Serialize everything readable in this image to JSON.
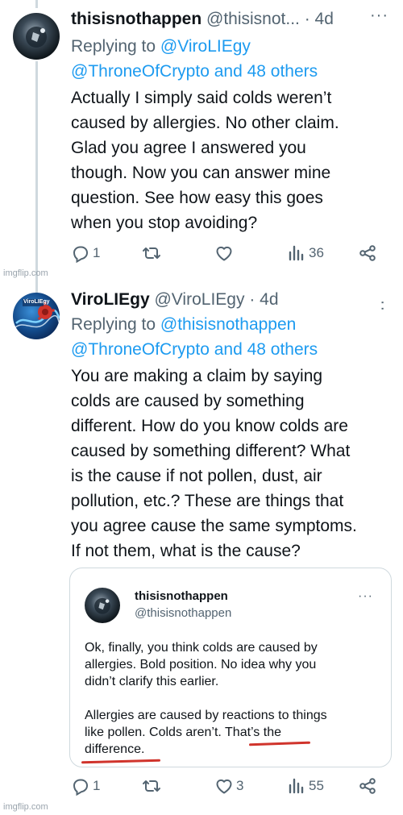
{
  "tweet1": {
    "name": "thisisnothappen",
    "handle": "@thisisnot...",
    "time": "· 4d",
    "replying_prefix": "Replying to ",
    "reply_to_1": "@ViroLIEgy",
    "reply_to_2": "@ThroneOfCrypto and 48 others",
    "lines": [
      "Actually I simply said colds weren’t",
      "caused by allergies. No other claim.",
      "Glad you agree I answered you",
      "though. Now you can answer mine",
      "question. See how easy this goes",
      "when you stop avoiding?"
    ],
    "replies": "1",
    "views": "36"
  },
  "tweet2": {
    "name": "ViroLIEgy",
    "handle": "@ViroLIEgy",
    "time": "· 4d",
    "avatar_text": "ViroLIEgy",
    "replying_prefix": "Replying to ",
    "reply_to_1": "@thisisnothappen",
    "reply_to_2": "@ThroneOfCrypto and 48 others",
    "lines": [
      "You are making a claim by saying",
      "colds are caused by something",
      "different. How do you know colds are",
      "caused by something different? What",
      "is the cause if not pollen, dust, air",
      "pollution, etc.? These are things that",
      "you agree cause the same symptoms.",
      "If not them, what is the cause?"
    ],
    "replies": "1",
    "likes": "3",
    "views": "55"
  },
  "quote": {
    "name": "thisisnothappen",
    "handle": "@thisisnothappen",
    "more": "···",
    "para1": [
      "Ok, finally, you think colds are caused by",
      "allergies. Bold position. No idea why you",
      "didn’t clarify this earlier."
    ],
    "para2": [
      "Allergies are caused by reactions to things",
      "like pollen. Colds aren’t. That’s the",
      "difference."
    ]
  },
  "watermark": "imgflip.com",
  "colors": {
    "link": "#1d9bf0",
    "secondary": "#536471",
    "border": "#cfd9de",
    "annotation": "#d0342c"
  },
  "icons": [
    "reply-icon",
    "retweet-icon",
    "like-icon",
    "views-icon",
    "share-icon",
    "more-icon"
  ]
}
